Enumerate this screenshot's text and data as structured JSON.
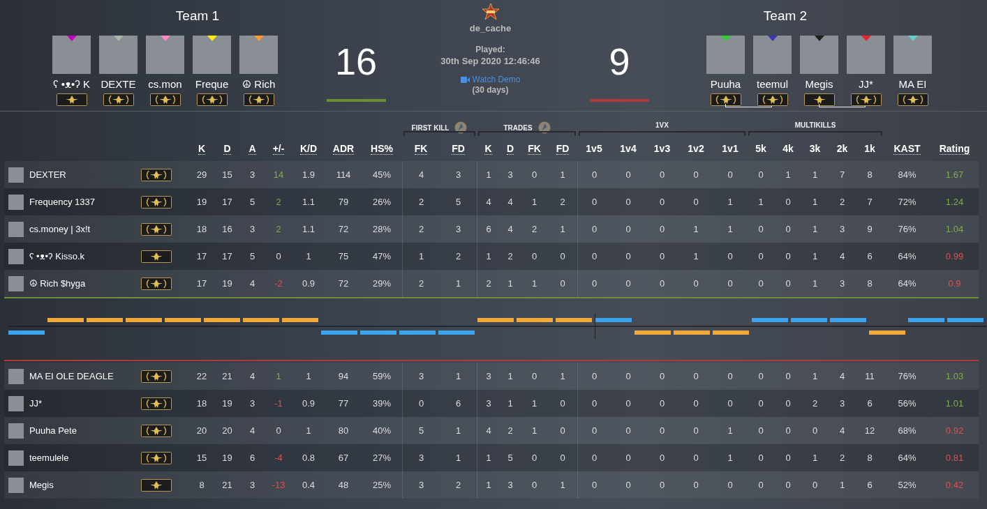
{
  "match": {
    "map": "de_cache",
    "played_label": "Played:",
    "played_at": "30th Sep 2020 12:46:46",
    "demo_link": "Watch Demo",
    "demo_note": "(30 days)"
  },
  "teams": [
    {
      "title": "Team 1",
      "score": "16",
      "color": "#6b8e3a",
      "header_players": [
        {
          "name": "ʕ •ᴥ•ʔ K",
          "color": "#c000c0",
          "laurels": false,
          "linked_to_next": false
        },
        {
          "name": "DEXTE",
          "color": "#a8b8a8",
          "laurels": true,
          "linked_to_next": false
        },
        {
          "name": "cs.mon",
          "color": "#ff88c8",
          "laurels": true,
          "linked_to_next": false
        },
        {
          "name": "Freque",
          "color": "#ffee00",
          "laurels": true,
          "linked_to_next": false
        },
        {
          "name": "☮ Rich",
          "color": "#ff9933",
          "laurels": true,
          "linked_to_next": false
        }
      ],
      "rows": [
        {
          "name": "DEXTER",
          "laurels": true,
          "values": [
            "29",
            "15",
            "3"
          ],
          "plus_minus": {
            "value": "14",
            "color": "#7fae4a"
          },
          "stats": [
            "1.9",
            "114",
            "45%",
            "4",
            "3",
            "1",
            "3",
            "0",
            "1",
            "0",
            "0",
            "0",
            "0",
            "0",
            "0",
            "1",
            "1",
            "7",
            "8",
            "84%"
          ],
          "rating": {
            "value": "1.67",
            "color": "#7fae4a"
          }
        },
        {
          "name": "Frequency 1337",
          "laurels": true,
          "values": [
            "19",
            "17",
            "5"
          ],
          "plus_minus": {
            "value": "2",
            "color": "#7fae4a"
          },
          "stats": [
            "1.1",
            "79",
            "26%",
            "2",
            "5",
            "4",
            "4",
            "1",
            "2",
            "0",
            "0",
            "0",
            "0",
            "1",
            "1",
            "0",
            "1",
            "2",
            "7",
            "72%"
          ],
          "rating": {
            "value": "1.24",
            "color": "#7fae4a"
          }
        },
        {
          "name": "cs.money | 3x!t",
          "laurels": true,
          "values": [
            "18",
            "16",
            "3"
          ],
          "plus_minus": {
            "value": "2",
            "color": "#7fae4a"
          },
          "stats": [
            "1.1",
            "72",
            "28%",
            "2",
            "3",
            "6",
            "4",
            "2",
            "1",
            "0",
            "0",
            "0",
            "1",
            "1",
            "0",
            "0",
            "1",
            "3",
            "9",
            "76%"
          ],
          "rating": {
            "value": "1.04",
            "color": "#7fae4a"
          }
        },
        {
          "name": "ʕ •ᴥ•ʔ Kisso.k",
          "laurels": false,
          "values": [
            "17",
            "17",
            "5"
          ],
          "plus_minus": {
            "value": "0",
            "color": "#dddddd"
          },
          "stats": [
            "1",
            "75",
            "47%",
            "1",
            "2",
            "1",
            "2",
            "0",
            "0",
            "0",
            "0",
            "0",
            "1",
            "0",
            "0",
            "0",
            "1",
            "4",
            "6",
            "64%"
          ],
          "rating": {
            "value": "0.99",
            "color": "#d9534f"
          }
        },
        {
          "name": "☮ Rich $hyga",
          "laurels": true,
          "values": [
            "17",
            "19",
            "4"
          ],
          "plus_minus": {
            "value": "-2",
            "color": "#d9534f"
          },
          "stats": [
            "0.9",
            "72",
            "29%",
            "2",
            "1",
            "2",
            "1",
            "1",
            "0",
            "0",
            "0",
            "0",
            "0",
            "0",
            "0",
            "0",
            "1",
            "3",
            "8",
            "64%"
          ],
          "rating": {
            "value": "0.9",
            "color": "#d9534f"
          }
        }
      ]
    },
    {
      "title": "Team 2",
      "score": "9",
      "color": "#b03a3a",
      "header_players": [
        {
          "name": "Puuha",
          "color": "#33cc33",
          "laurels": true,
          "linked_to_next": true
        },
        {
          "name": "teemul",
          "color": "#3838b0",
          "laurels": true,
          "linked_to_next": false
        },
        {
          "name": "Megis",
          "color": "#202020",
          "laurels": false,
          "linked_to_next": true
        },
        {
          "name": "JJ*",
          "color": "#ee2233",
          "laurels": true,
          "linked_to_next": false
        },
        {
          "name": "MA EI",
          "color": "#66cccc",
          "laurels": true,
          "linked_to_next": false
        }
      ],
      "rows": [
        {
          "name": "MA EI OLE DEAGLE",
          "laurels": true,
          "values": [
            "22",
            "21",
            "4"
          ],
          "plus_minus": {
            "value": "1",
            "color": "#7fae4a"
          },
          "stats": [
            "1",
            "94",
            "59%",
            "3",
            "1",
            "3",
            "1",
            "0",
            "1",
            "0",
            "0",
            "0",
            "0",
            "0",
            "0",
            "0",
            "1",
            "4",
            "11",
            "76%"
          ],
          "rating": {
            "value": "1.03",
            "color": "#7fae4a"
          }
        },
        {
          "name": "JJ*",
          "laurels": true,
          "values": [
            "18",
            "19",
            "3"
          ],
          "plus_minus": {
            "value": "-1",
            "color": "#d9534f"
          },
          "stats": [
            "0.9",
            "77",
            "39%",
            "0",
            "6",
            "3",
            "1",
            "1",
            "0",
            "0",
            "0",
            "0",
            "0",
            "0",
            "0",
            "0",
            "2",
            "3",
            "6",
            "56%"
          ],
          "rating": {
            "value": "1.01",
            "color": "#7fae4a"
          }
        },
        {
          "name": "Puuha Pete",
          "laurels": true,
          "values": [
            "20",
            "20",
            "4"
          ],
          "plus_minus": {
            "value": "0",
            "color": "#dddddd"
          },
          "stats": [
            "1",
            "80",
            "40%",
            "5",
            "1",
            "4",
            "2",
            "1",
            "0",
            "0",
            "0",
            "0",
            "0",
            "1",
            "0",
            "0",
            "0",
            "4",
            "12",
            "68%"
          ],
          "rating": {
            "value": "0.92",
            "color": "#d9534f"
          }
        },
        {
          "name": "teemulele",
          "laurels": true,
          "values": [
            "15",
            "19",
            "6"
          ],
          "plus_minus": {
            "value": "-4",
            "color": "#d9534f"
          },
          "stats": [
            "0.8",
            "67",
            "27%",
            "3",
            "1",
            "1",
            "5",
            "0",
            "0",
            "0",
            "0",
            "0",
            "0",
            "1",
            "0",
            "0",
            "1",
            "2",
            "8",
            "64%"
          ],
          "rating": {
            "value": "0.81",
            "color": "#d9534f"
          }
        },
        {
          "name": "Megis",
          "laurels": false,
          "values": [
            "8",
            "21",
            "3"
          ],
          "plus_minus": {
            "value": "-13",
            "color": "#d9534f"
          },
          "stats": [
            "0.4",
            "48",
            "25%",
            "3",
            "2",
            "1",
            "3",
            "0",
            "1",
            "0",
            "0",
            "0",
            "0",
            "0",
            "0",
            "0",
            "0",
            "1",
            "6",
            "52%"
          ],
          "rating": {
            "value": "0.42",
            "color": "#d9534f"
          }
        }
      ]
    }
  ],
  "column_groups": [
    {
      "columns": [
        {
          "label": "K",
          "abbr": true
        },
        {
          "label": "D",
          "abbr": true
        },
        {
          "label": "A",
          "abbr": true
        },
        {
          "label": "+/-",
          "abbr": true
        },
        {
          "label": "K/D",
          "abbr": true
        },
        {
          "label": "ADR",
          "abbr": true
        },
        {
          "label": "HS%",
          "abbr": true
        }
      ]
    },
    {
      "title": "FIRST KILL",
      "has_icon": true,
      "columns": [
        {
          "label": "FK",
          "abbr": true
        },
        {
          "label": "FD",
          "abbr": true
        }
      ]
    },
    {
      "title": "TRADES",
      "has_icon": true,
      "columns": [
        {
          "label": "K",
          "abbr": true
        },
        {
          "label": "D",
          "abbr": true
        },
        {
          "label": "FK",
          "abbr": true
        },
        {
          "label": "FD",
          "abbr": true
        }
      ]
    },
    {
      "title": "1VX",
      "has_icon": false,
      "columns": [
        {
          "label": "1v5",
          "abbr": false
        },
        {
          "label": "1v4",
          "abbr": false
        },
        {
          "label": "1v3",
          "abbr": false
        },
        {
          "label": "1v2",
          "abbr": false
        },
        {
          "label": "1v1",
          "abbr": false
        }
      ]
    },
    {
      "title": "MULTIKILLS",
      "has_icon": false,
      "columns": [
        {
          "label": "5k",
          "abbr": false
        },
        {
          "label": "4k",
          "abbr": false
        },
        {
          "label": "3k",
          "abbr": false
        },
        {
          "label": "2k",
          "abbr": false
        },
        {
          "label": "1k",
          "abbr": false
        }
      ]
    },
    {
      "columns": [
        {
          "label": "KAST",
          "abbr": true
        },
        {
          "label": "Rating",
          "abbr": true
        }
      ]
    }
  ],
  "round_history": {
    "halves": [
      {
        "rounds": [
          {
            "team1_won": false,
            "color": "#3ca4ee"
          },
          {
            "team1_won": true,
            "color": "#f2a93b"
          },
          {
            "team1_won": true,
            "color": "#f2a93b"
          },
          {
            "team1_won": true,
            "color": "#f2a93b"
          },
          {
            "team1_won": true,
            "color": "#f2a93b"
          },
          {
            "team1_won": true,
            "color": "#f2a93b"
          },
          {
            "team1_won": true,
            "color": "#f2a93b"
          },
          {
            "team1_won": true,
            "color": "#f2a93b"
          },
          {
            "team1_won": false,
            "color": "#3ca4ee"
          },
          {
            "team1_won": false,
            "color": "#3ca4ee"
          },
          {
            "team1_won": false,
            "color": "#3ca4ee"
          },
          {
            "team1_won": false,
            "color": "#3ca4ee"
          },
          {
            "team1_won": true,
            "color": "#f2a93b"
          },
          {
            "team1_won": true,
            "color": "#f2a93b"
          },
          {
            "team1_won": true,
            "color": "#f2a93b"
          }
        ]
      },
      {
        "rounds": [
          {
            "team1_won": true,
            "color": "#3ca4ee"
          },
          {
            "team1_won": false,
            "color": "#f2a93b"
          },
          {
            "team1_won": false,
            "color": "#f2a93b"
          },
          {
            "team1_won": false,
            "color": "#f2a93b"
          },
          {
            "team1_won": true,
            "color": "#3ca4ee"
          },
          {
            "team1_won": true,
            "color": "#3ca4ee"
          },
          {
            "team1_won": true,
            "color": "#3ca4ee"
          },
          {
            "team1_won": false,
            "color": "#f2a93b"
          },
          {
            "team1_won": true,
            "color": "#3ca4ee"
          },
          {
            "team1_won": true,
            "color": "#3ca4ee"
          }
        ]
      }
    ]
  }
}
